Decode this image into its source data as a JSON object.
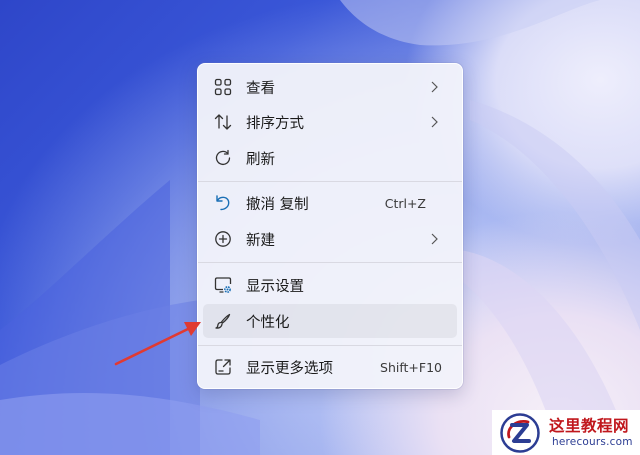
{
  "menu": {
    "items": [
      {
        "label": "查看",
        "icon": "grid-icon",
        "submenu": true
      },
      {
        "label": "排序方式",
        "icon": "sort-icon",
        "submenu": true
      },
      {
        "label": "刷新",
        "icon": "refresh-icon",
        "submenu": false
      },
      {
        "label": "撤消 复制",
        "icon": "undo-icon",
        "shortcut": "Ctrl+Z",
        "submenu": false
      },
      {
        "label": "新建",
        "icon": "new-icon",
        "submenu": true
      },
      {
        "label": "显示设置",
        "icon": "display-settings-icon",
        "submenu": false
      },
      {
        "label": "个性化",
        "icon": "brush-icon",
        "submenu": false,
        "highlighted": true
      },
      {
        "label": "显示更多选项",
        "icon": "more-options-icon",
        "shortcut": "Shift+F10",
        "submenu": false
      }
    ]
  },
  "watermark": {
    "title": "这里教程网",
    "subtitle": "herecours.com"
  },
  "colors": {
    "annotation_arrow": "#e03a32",
    "undo_icon": "#1a6fb5",
    "settings_gear": "#1a6fb5",
    "watermark_title": "#c0171c",
    "watermark_sub": "#2c3d93"
  }
}
